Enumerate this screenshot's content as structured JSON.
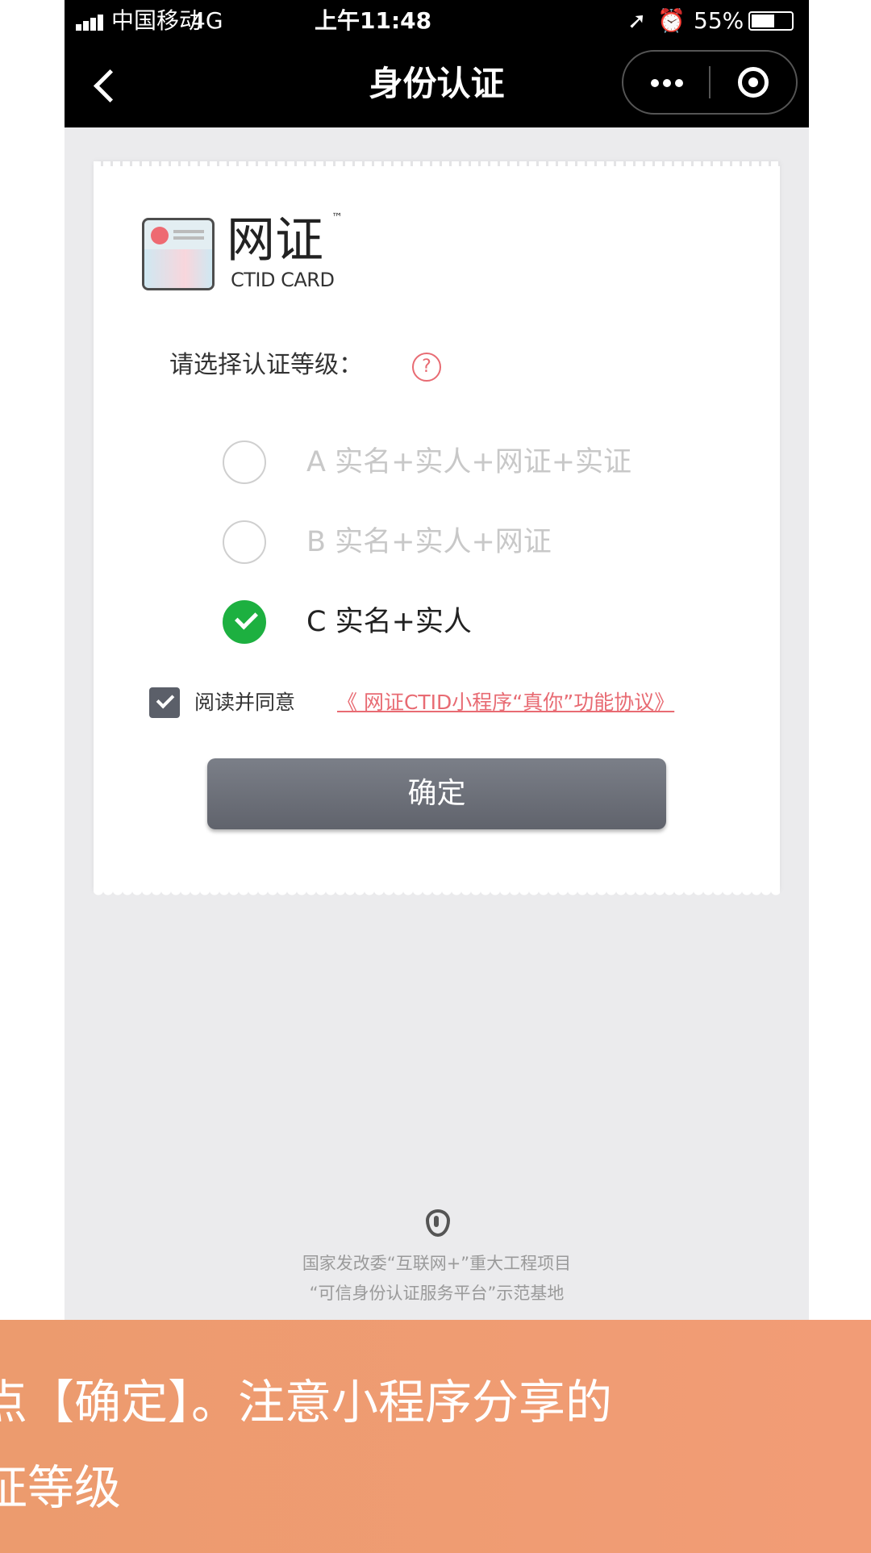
{
  "statusbar": {
    "carrier": "中国移动",
    "network": "4G",
    "time": "上午11:48",
    "battery": "55%"
  },
  "navbar": {
    "title": "身份认证"
  },
  "logo": {
    "title": "网证",
    "tm": "™",
    "subtitle": "CTID CARD"
  },
  "form": {
    "prompt": "请选择认证等级：",
    "help": "?",
    "options": [
      {
        "label": "A 实名+实人+网证+实证",
        "selected": false
      },
      {
        "label": "B 实名+实人+网证",
        "selected": false
      },
      {
        "label": "C 实名+实人",
        "selected": true
      }
    ],
    "agree_text": "阅读并同意",
    "agree_link": "《 网证CTID小程序“真你”功能协议》",
    "agree_checked": true,
    "confirm_label": "确定"
  },
  "footer": {
    "line1": "国家发改委“互联网+”重大工程项目",
    "line2": "“可信身份认证服务平台”示范基地"
  },
  "banner": {
    "line1": "点【确定】。注意小程序分享的",
    "line2": "证等级"
  },
  "colors": {
    "accent": "#e86b73",
    "selected": "#1db040",
    "banner": "#ef9b71"
  }
}
